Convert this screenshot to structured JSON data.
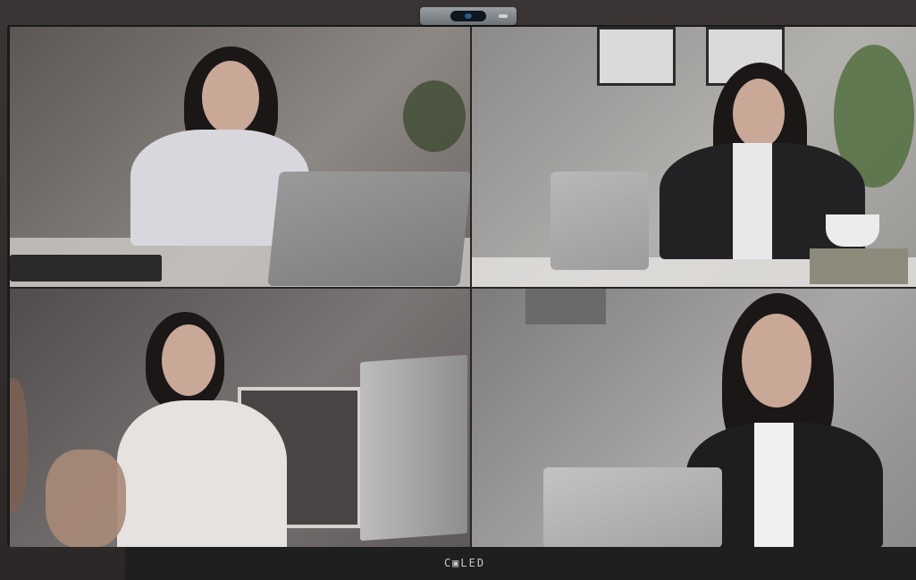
{
  "screen": {
    "brand_label": "C▣LED",
    "participants": [
      {
        "label": "participant-1"
      },
      {
        "label": "participant-2"
      },
      {
        "label": "participant-3"
      },
      {
        "label": "participant-4"
      }
    ]
  },
  "colors": {
    "bezel": "#1b1a1a",
    "background": "#2b2727",
    "camera": "#8a9093"
  },
  "icons": [
    "webcam-icon"
  ]
}
